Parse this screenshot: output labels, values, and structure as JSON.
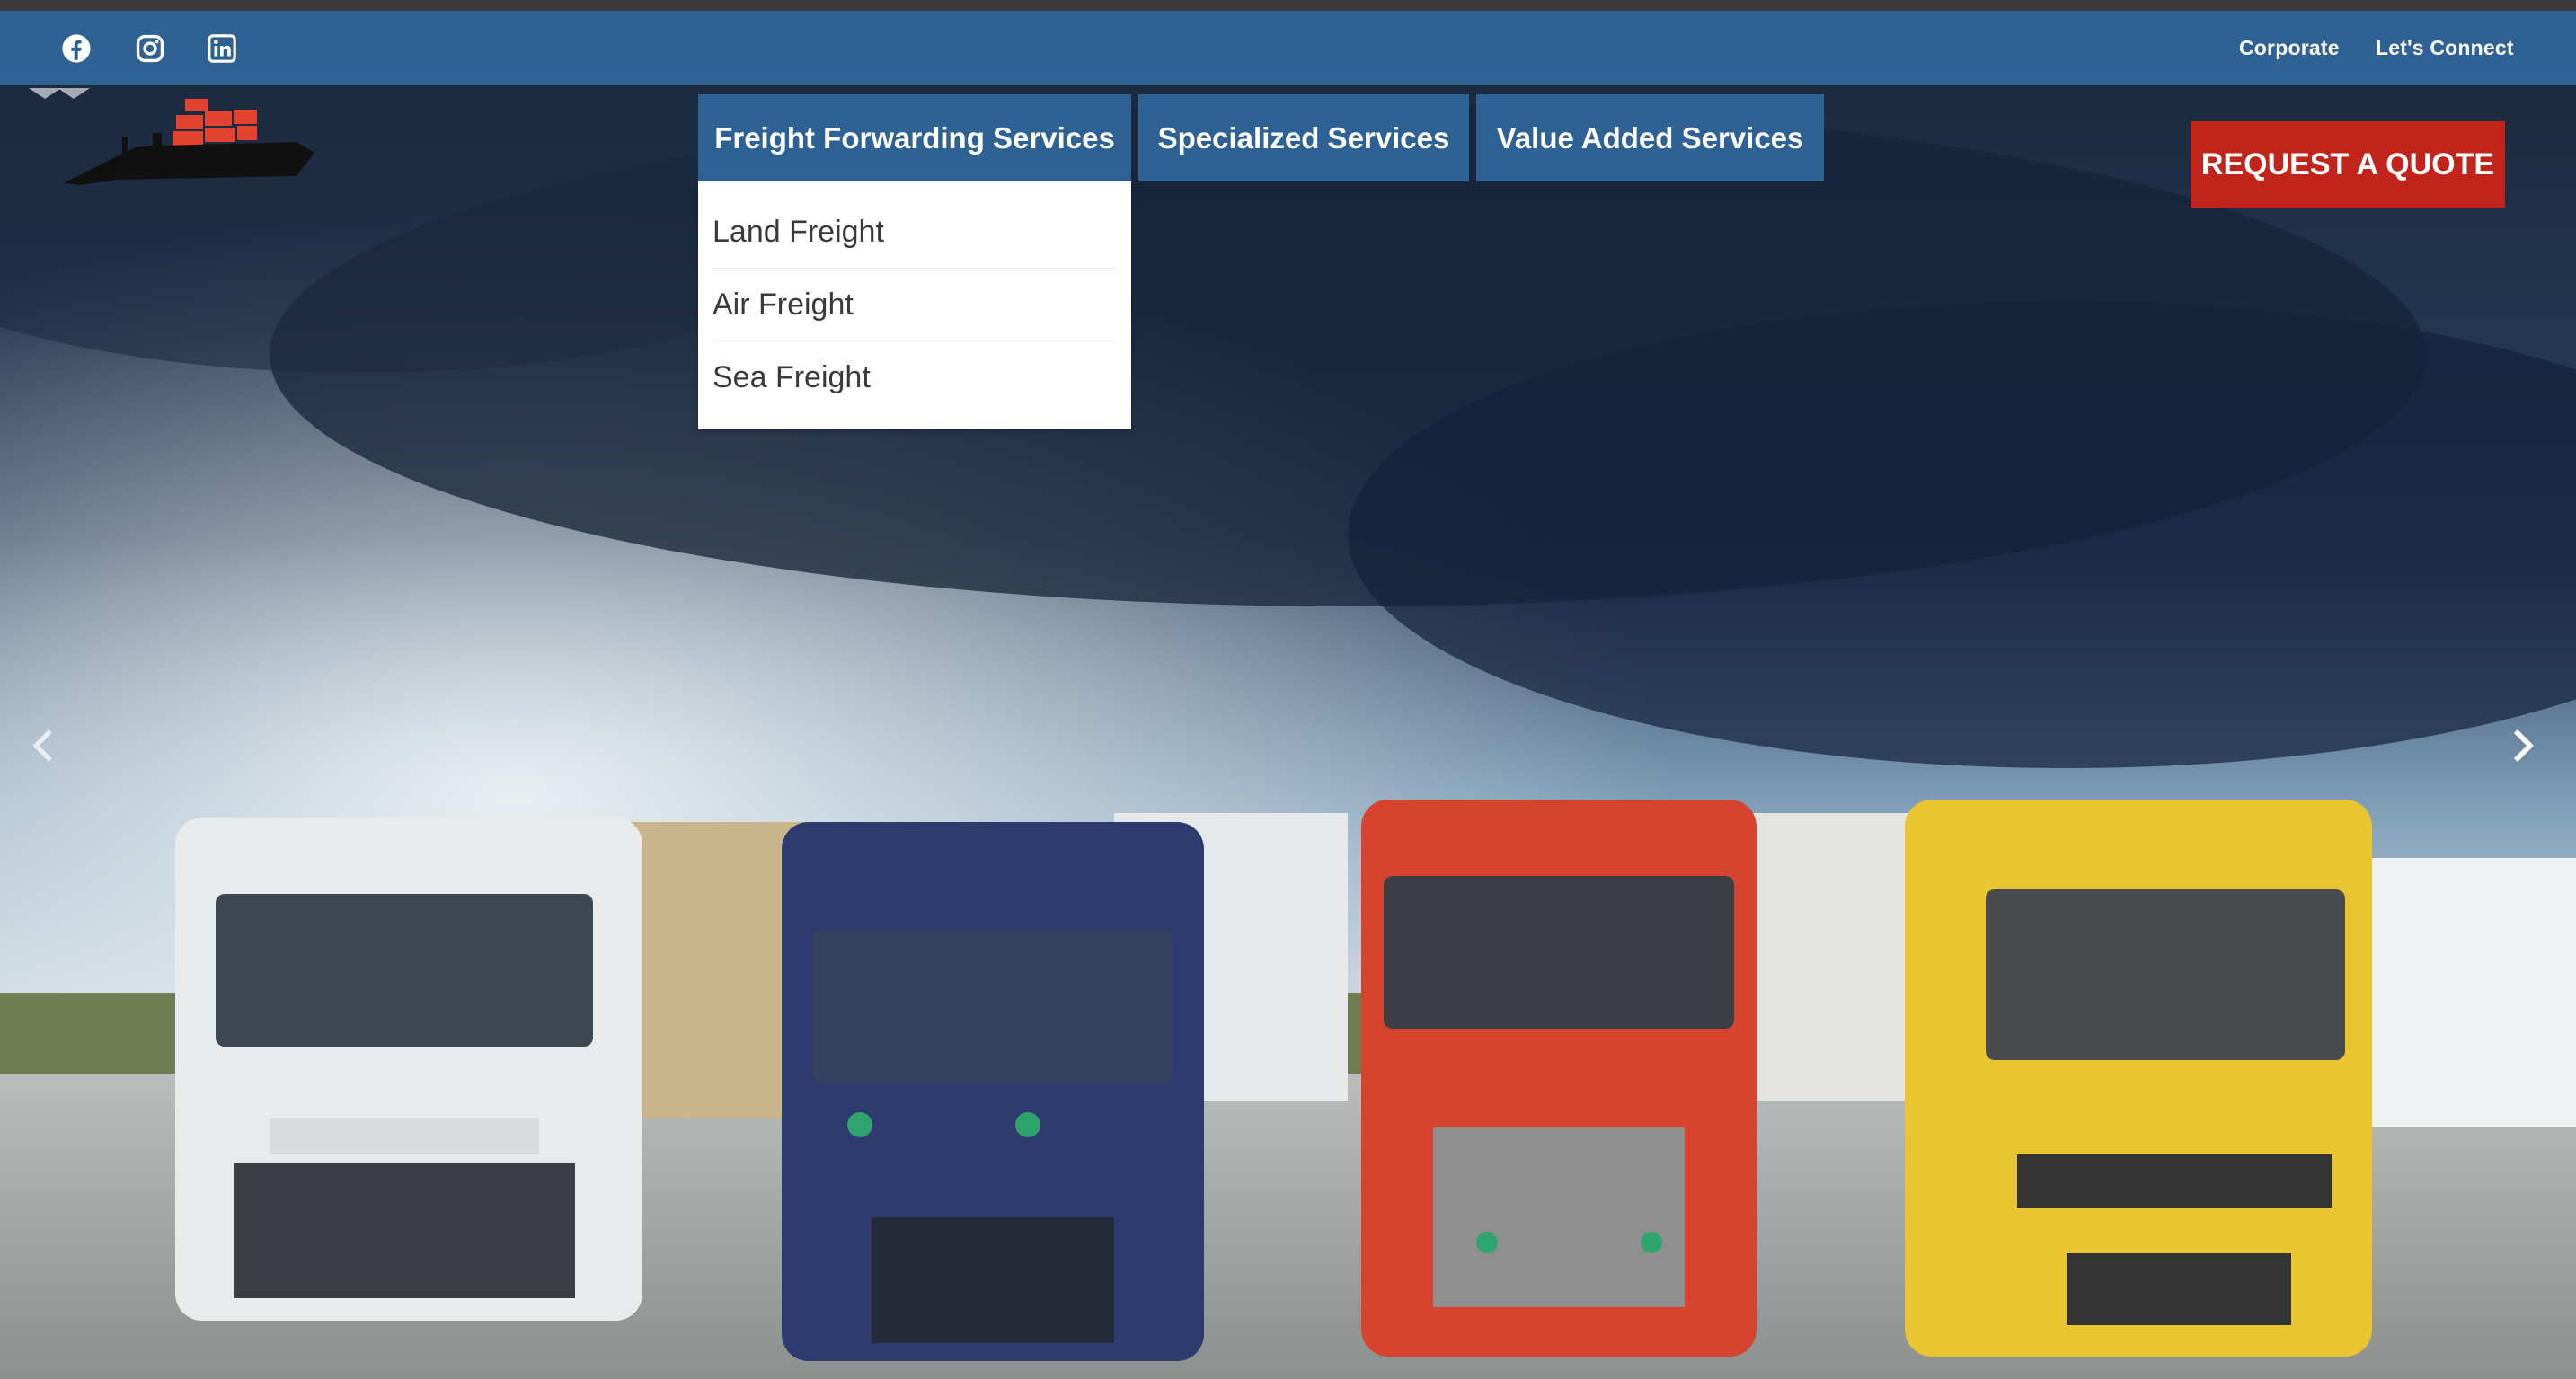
{
  "topbar": {
    "social": [
      {
        "icon": "facebook-icon"
      },
      {
        "icon": "instagram-icon"
      },
      {
        "icon": "linkedin-icon"
      }
    ],
    "links": [
      "Corporate",
      "Let's Connect"
    ]
  },
  "nav": {
    "items": [
      "Freight Forwarding Services",
      "Specialized Services",
      "Value Added Services"
    ],
    "dropdown": [
      "Land Freight",
      "Air Freight",
      "Sea Freight"
    ]
  },
  "cta": {
    "label": "REQUEST A QUOTE"
  },
  "carousel": {
    "prev_icon": "chevron-left-icon",
    "next_icon": "chevron-right-icon"
  },
  "colors": {
    "topbar": "#2e6294",
    "nav": "#2e6294",
    "cta": "#c0241b",
    "logo_containers": "#e2442f"
  }
}
